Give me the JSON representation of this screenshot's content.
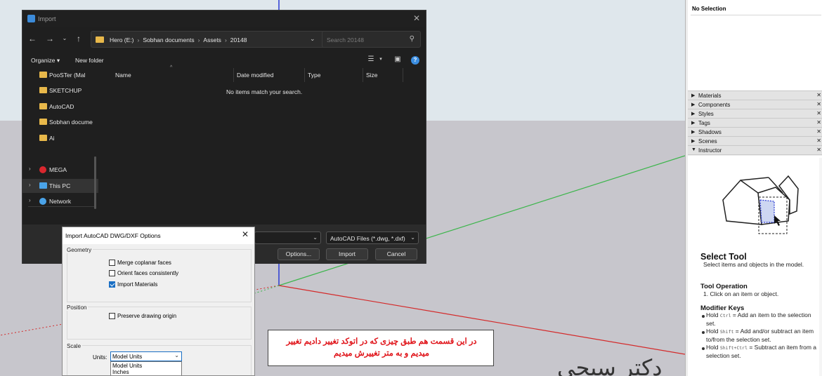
{
  "file_dialog": {
    "title": "Import",
    "breadcrumbs": [
      "Hero (E:)",
      "Sobhan documents",
      "Assets",
      "20148"
    ],
    "search_placeholder": "Search 20148",
    "organize_label": "Organize ▾",
    "new_folder_label": "New folder",
    "sidebar": [
      {
        "label": "PooSTer (Mal"
      },
      {
        "label": "SKETCHUP"
      },
      {
        "label": "AutoCAD"
      },
      {
        "label": "Sobhan docume"
      },
      {
        "label": "Ai"
      },
      {
        "label": "MEGA"
      },
      {
        "label": "This PC"
      },
      {
        "label": "Network"
      }
    ],
    "columns": [
      "Name",
      "Date modified",
      "Type",
      "Size"
    ],
    "empty_message": "No items match your search.",
    "file_type": "AutoCAD Files (*.dwg, *.dxf)",
    "options_label": "Options...",
    "import_label": "Import",
    "cancel_label": "Cancel"
  },
  "cad_dialog": {
    "title": "Import AutoCAD DWG/DXF Options",
    "geometry_label": "Geometry",
    "merge_label": "Merge coplanar faces",
    "merge_checked": false,
    "orient_label": "Orient faces consistently",
    "orient_checked": false,
    "import_materials_label": "Import Materials",
    "import_materials_checked": true,
    "position_label": "Position",
    "preserve_label": "Preserve drawing origin",
    "preserve_checked": false,
    "scale_label": "Scale",
    "units_label": "Units:",
    "units_selected": "Model Units",
    "units_options": [
      "Model Units",
      "Inches"
    ]
  },
  "caption": {
    "line1": "در این قسمت هم طبق چیزی که در اتوکد تغییر دادیم تغییر",
    "line2": "میدیم و به متر تغییرش میدیم"
  },
  "logo": {
    "text": "دکتر سبحی"
  },
  "tray": {
    "entity_info": "No Selection",
    "panels": [
      "Materials",
      "Components",
      "Styles",
      "Tags",
      "Shadows",
      "Scenes",
      "Instructor"
    ],
    "instructor": {
      "title": "Select Tool",
      "description": "Select items and objects in the model.",
      "operation_heading": "Tool Operation",
      "operation_step": "1. Click on an item or object.",
      "modifier_heading": "Modifier Keys",
      "mod1_key": "Ctrl",
      "mod1_text": " = Add an item to the selection set.",
      "mod2_key": "Shift",
      "mod2_text": " = Add and/or subtract an item to/from the selection set.",
      "mod3_key": "Shift+Ctrl",
      "mod3_text": " = Subtract an item from a selection set."
    }
  },
  "colors": {
    "dialog_dark": "#1f1f1f",
    "accent_blue": "#1a6fc4",
    "caption_red": "#e0141a",
    "axis_green": "#3bb54a",
    "axis_red": "#d42a2a",
    "axis_blue": "#2a3ad4"
  }
}
